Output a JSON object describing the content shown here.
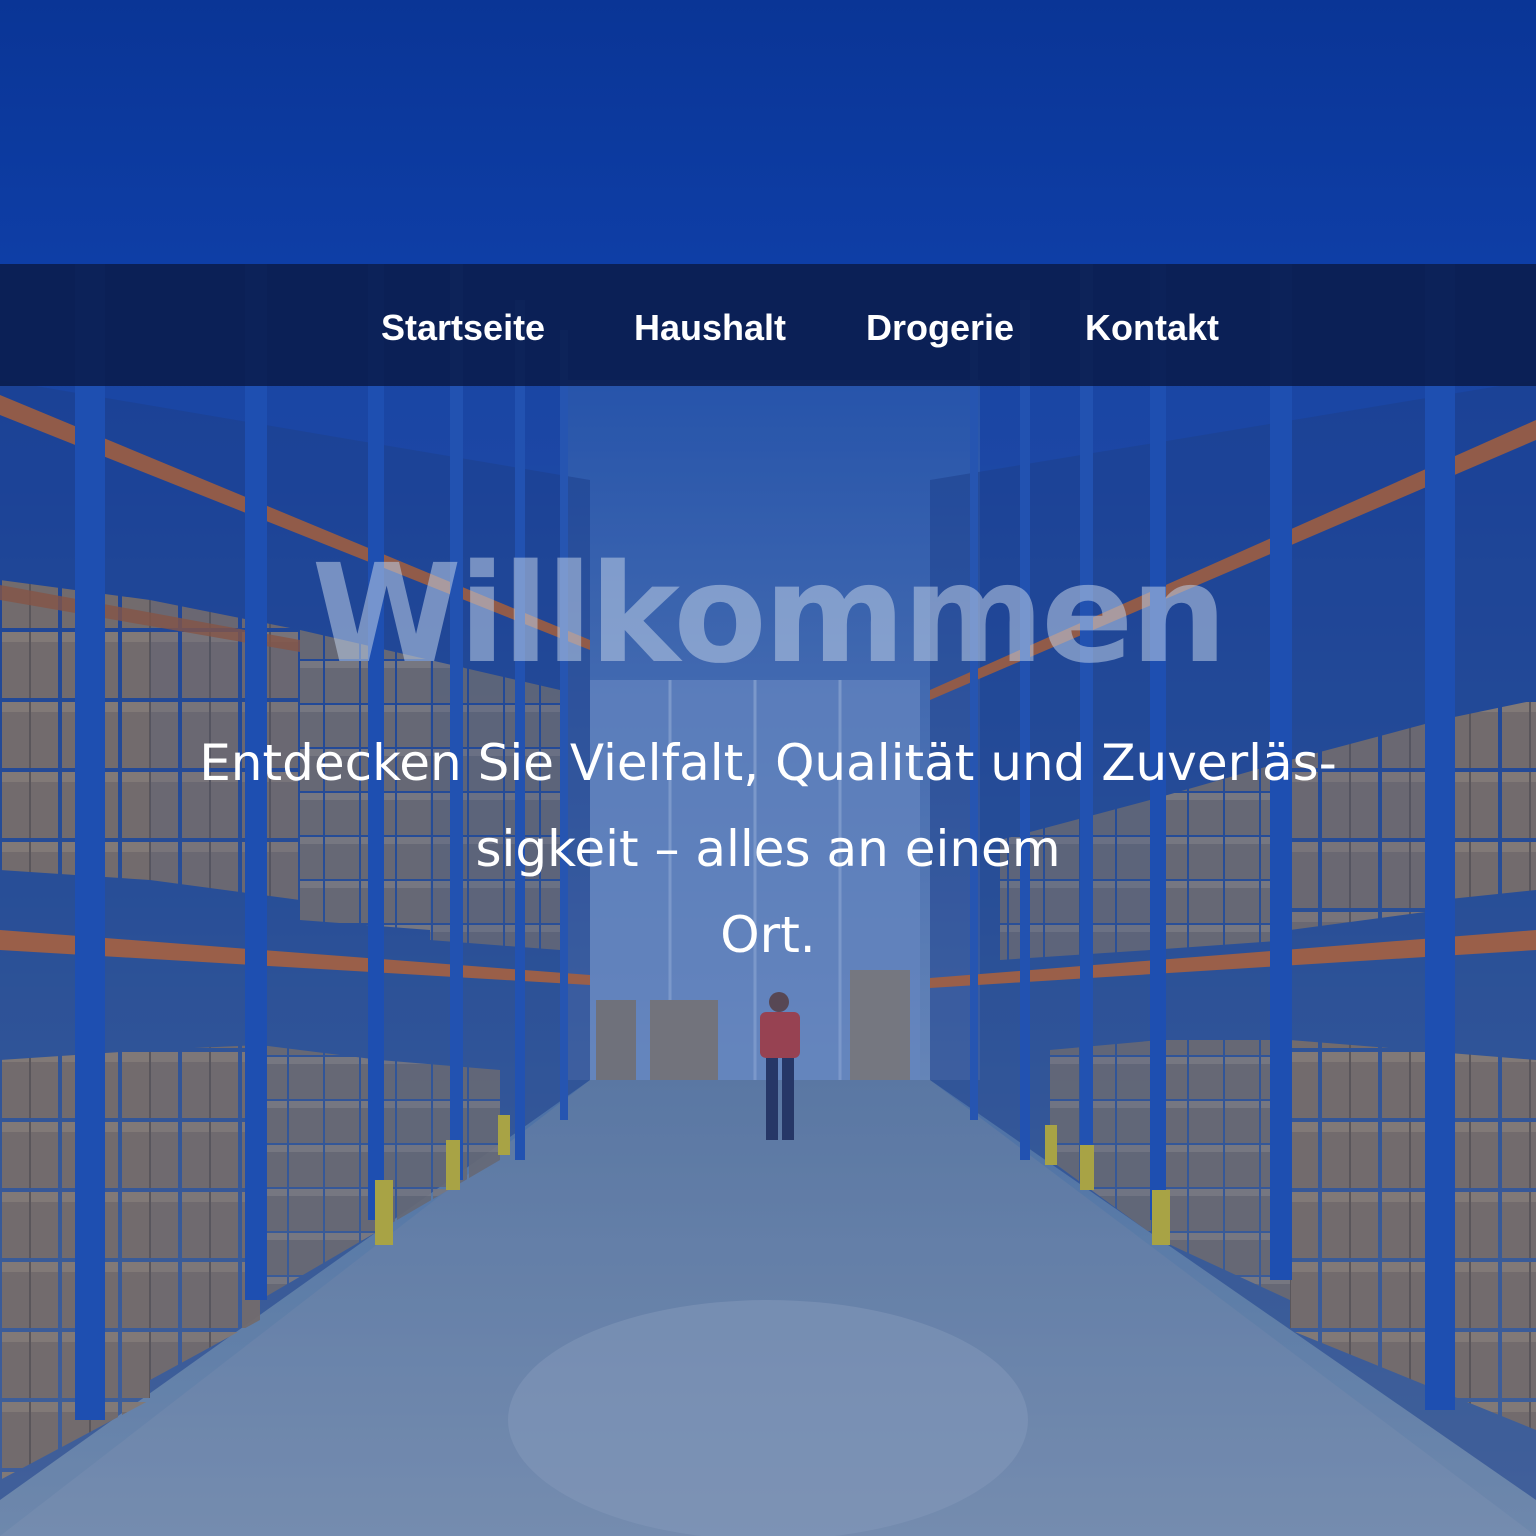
{
  "nav": {
    "items": [
      {
        "label": "Startseite"
      },
      {
        "label": "Haushalt"
      },
      {
        "label": "Drogerie"
      },
      {
        "label": "Kontakt"
      }
    ]
  },
  "hero": {
    "title": "Willkommen",
    "subtitle_line1": "Entdecken Sie Vielfalt, Qualität und Zuverläs-",
    "subtitle_line2": "sigkeit – alles an einem",
    "subtitle_line3": "Ort."
  },
  "colors": {
    "header_blue": "#0a3596",
    "nav_bar": "#08184a",
    "shelf_blue": "#1f55b8",
    "shelf_orange": "#c46a2e",
    "box_brown": "#a0845e",
    "floor": "#8aa0b2"
  }
}
